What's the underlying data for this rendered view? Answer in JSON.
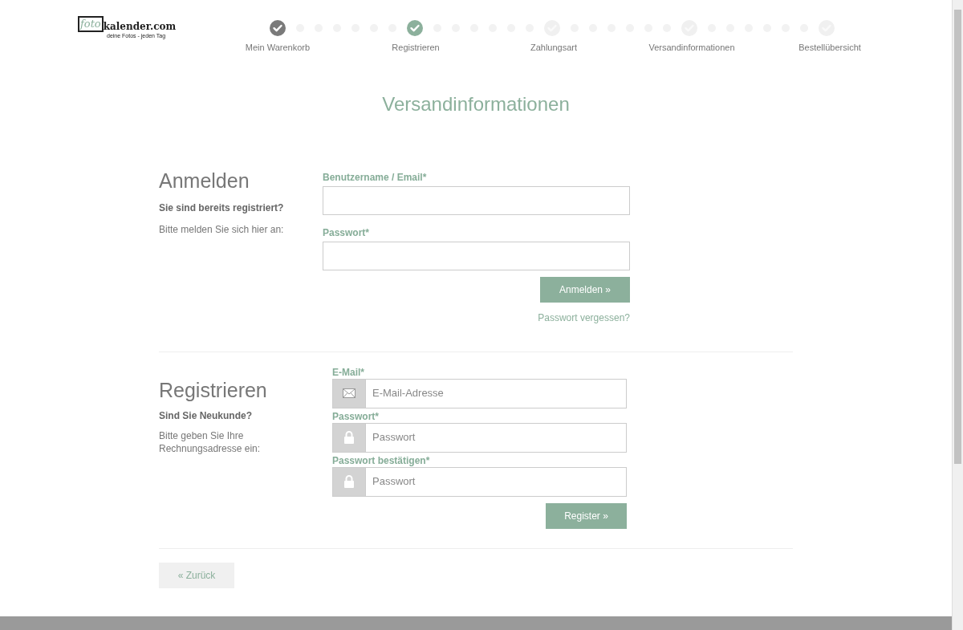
{
  "logo": {
    "part1": "foto",
    "part2": "kalender.com",
    "tagline": "deine Fotos - jeden Tag"
  },
  "steps": [
    {
      "label": "Mein Warenkorb",
      "completed": true,
      "selected": false
    },
    {
      "label": "Registrieren",
      "completed": true,
      "selected": true
    },
    {
      "label": "Zahlungsart",
      "completed": false,
      "selected": false
    },
    {
      "label": "Versandinformationen",
      "completed": false,
      "selected": false
    },
    {
      "label": "Bestellübersicht",
      "completed": false,
      "selected": false
    }
  ],
  "page_title": "Versandinformationen",
  "login": {
    "heading": "Anmelden",
    "subheading": "Sie sind bereits registriert?",
    "text": "Bitte melden Sie sich hier an:",
    "fields": [
      {
        "label": "Benutzername / Email*"
      },
      {
        "label": "Passwort*"
      }
    ],
    "button": "Anmelden »",
    "link": "Passwort vergessen?"
  },
  "register": {
    "heading": "Registrieren",
    "subheading": "Sind Sie Neukunde?",
    "text": "Bitte geben Sie Ihre Rechnungsadresse ein:",
    "fields": [
      {
        "label": "E-Mail*",
        "placeholder": "E-Mail-Adresse",
        "kind": "email"
      },
      {
        "label": "Passwort*",
        "placeholder": "Passwort",
        "kind": "password"
      },
      {
        "label": "Passwort bestätigen*",
        "placeholder": "Passwort",
        "kind": "password"
      }
    ],
    "button": "Register »"
  },
  "back_button": "« Zurück"
}
